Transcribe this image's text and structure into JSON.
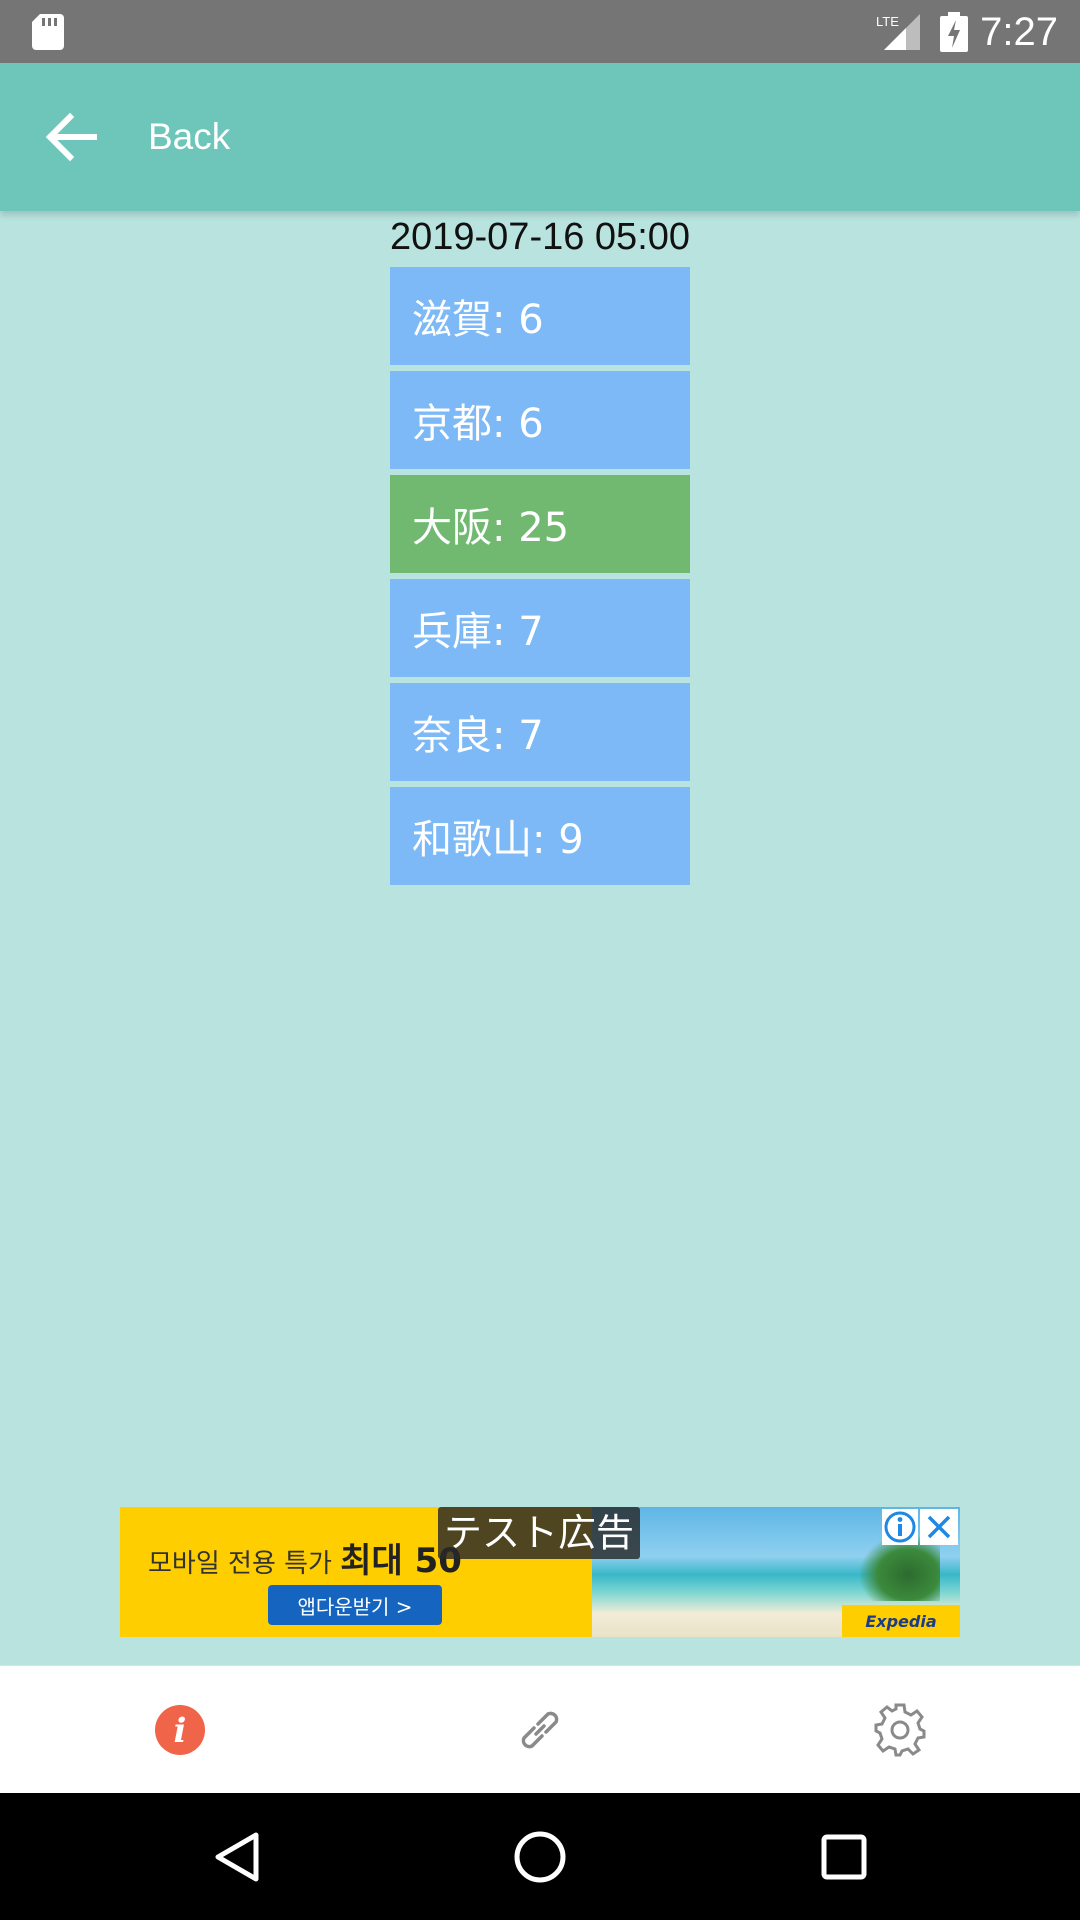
{
  "status_bar": {
    "time": "7:27",
    "network": "LTE",
    "icons": [
      "sd-card-icon",
      "lte-signal-icon",
      "battery-charging-icon"
    ]
  },
  "app_bar": {
    "back_label": "Back",
    "back_icon": "arrow-left-icon",
    "background_color": "#6ec6bb"
  },
  "timestamp": "2019-07-16 05:00",
  "prefectures": [
    {
      "label": "滋賀: 6",
      "highlight": false
    },
    {
      "label": "京都: 6",
      "highlight": false
    },
    {
      "label": "大阪: 25",
      "highlight": true
    },
    {
      "label": "兵庫: 7",
      "highlight": false
    },
    {
      "label": "奈良: 7",
      "highlight": false
    },
    {
      "label": "和歌山: 9",
      "highlight": false
    }
  ],
  "colors": {
    "page_background": "#b8e3df",
    "item_default": "#7cb9f6",
    "item_highlight": "#71b871"
  },
  "ad": {
    "test_label": "テスト広告",
    "headline_prefix": "모바일 전용 특가",
    "headline_strong": "최대 50",
    "cta": "앱다운받기 >",
    "brand": "Expedia",
    "info_icon": "ad-info-icon",
    "close_icon": "ad-close-icon"
  },
  "bottom_nav": {
    "items": [
      {
        "icon": "info-icon",
        "active": true
      },
      {
        "icon": "link-icon",
        "active": false
      },
      {
        "icon": "gear-icon",
        "active": false
      }
    ]
  },
  "system_nav": [
    "back-triangle-icon",
    "home-circle-icon",
    "recents-square-icon"
  ]
}
